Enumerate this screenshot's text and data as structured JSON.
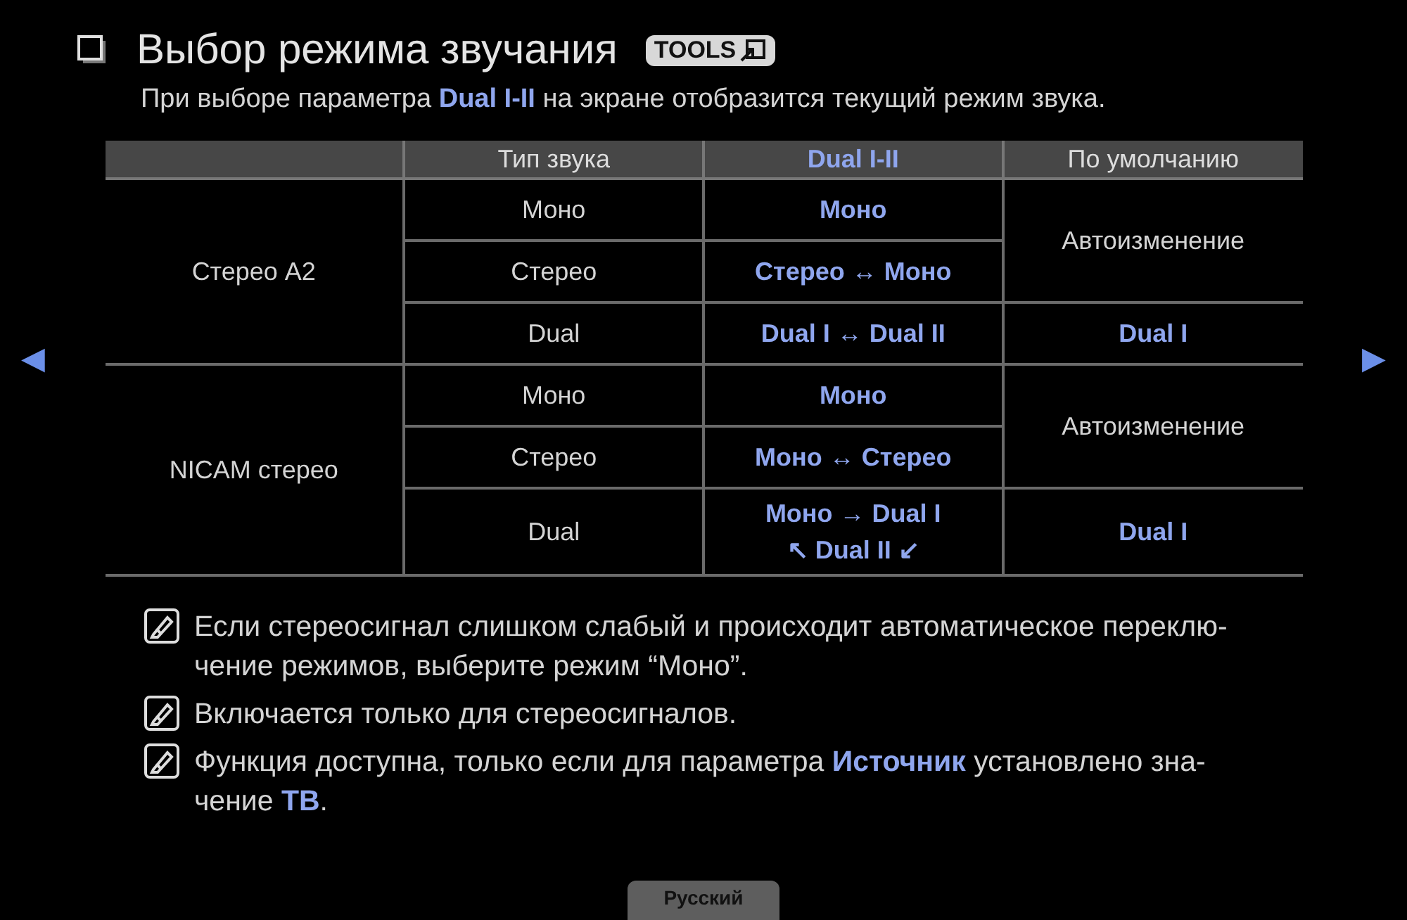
{
  "title": "Выбор режима звучания",
  "tools_badge": "TOOLS",
  "subtitle": "При выборе параметра **Dual I-II** на экране отобразится текущий режим звука.",
  "table": {
    "columns": [
      {
        "label": "Тип звука",
        "highlighted": false
      },
      {
        "label": "Dual I-II",
        "highlighted": true
      },
      {
        "label": "По умолчанию",
        "highlighted": false
      }
    ],
    "groups": [
      {
        "signal": "Стерео A2",
        "defaults": [
          {
            "text": "Автоизменение",
            "highlighted": false,
            "modes": [
              {
                "type": "Моно",
                "dual": "Моно"
              },
              {
                "type": "Стерео",
                "dual": "Стерео ↔ Моно"
              }
            ]
          },
          {
            "text": "Dual I",
            "highlighted": true,
            "modes": [
              {
                "type": "Dual",
                "dual": "Dual I ↔ Dual II"
              }
            ]
          }
        ]
      },
      {
        "signal": "NICAM стерео",
        "defaults": [
          {
            "text": "Автоизменение",
            "highlighted": false,
            "modes": [
              {
                "type": "Моно",
                "dual": "Моно"
              },
              {
                "type": "Стерео",
                "dual": "Моно ↔ Стерео"
              }
            ]
          },
          {
            "text": "Dual I",
            "highlighted": true,
            "modes": [
              {
                "type": "Dual",
                "dual": "Моно → Dual I\n↖ Dual II ↙"
              }
            ]
          }
        ]
      }
    ]
  },
  "notes": [
    "Если стереосигнал слишком слабый и происходит автоматическое переклю-\nчение режимов, выберите режим “Моно”.",
    "Включается только для стереосигналов.",
    "Функция доступна, только если для параметра **Источник** установлено зна-\nчение **ТВ**."
  ],
  "nav": {
    "prev": "◀",
    "next": "▶"
  },
  "language": "Русский"
}
